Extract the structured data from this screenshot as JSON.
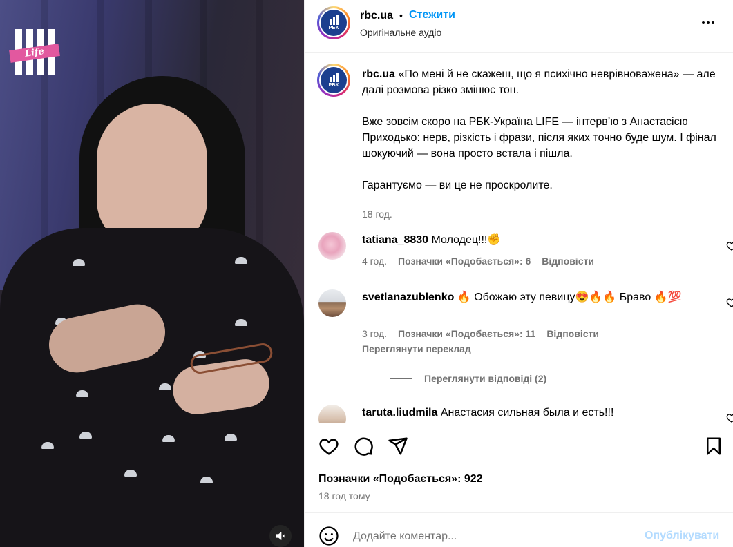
{
  "media": {
    "logo_text": "Life",
    "mute_icon": "speaker-muted-icon"
  },
  "header": {
    "username": "rbc.ua",
    "separator": "•",
    "follow_label": "Стежити",
    "audio": "Оригінальне аудіо",
    "avatar_text": "РБК",
    "more_icon": "more-horizontal-icon"
  },
  "caption": {
    "username": "rbc.ua",
    "prefix_glyph": "",
    "paragraphs": [
      "«По мені й не скажеш, що я психічно неврівноважена» — але далі розмова різко змінює тон.",
      "Вже зовсім скоро на РБК-Україна LIFE — інтерв’ю з Анастасією Приходько: нерв, різкість і фрази, після яких точно буде шум. І фінал шокуючий — вона просто встала і пішла.",
      "Гарантуємо — ви це не проскролите."
    ],
    "time": "18 год."
  },
  "comments": [
    {
      "username": "tatiana_8830",
      "text": "Молодец!!!✊",
      "time": "4 год.",
      "likes": "Позначки «Подобається»: 6",
      "reply": "Відповісти"
    },
    {
      "username": "svetlanazublenko",
      "text": "🔥 Обожаю эту певицу😍🔥🔥 Браво 🔥💯",
      "time": "3 год.",
      "likes": "Позначки «Подобається»: 11",
      "reply": "Відповісти",
      "translate": "Переглянути переклад",
      "view_replies": "Переглянути відповіді (2)"
    },
    {
      "username": "taruta.liudmila",
      "text": "Анастасия сильная была и есть!!!"
    }
  ],
  "actions": {
    "likes": "Позначки «Подобається»: 922",
    "ago": "18 год тому"
  },
  "composer": {
    "placeholder": "Додайте коментар...",
    "post_label": "Опублікувати"
  },
  "colors": {
    "accent": "#0095f6",
    "muted_text": "#737373",
    "post_disabled": "#b3dbff",
    "avatar_bg": "#1c3f8f"
  }
}
